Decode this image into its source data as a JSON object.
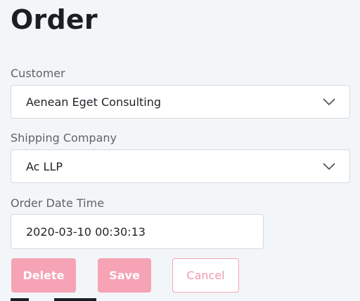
{
  "page": {
    "title": "Order"
  },
  "form": {
    "customer": {
      "label": "Customer",
      "value": "Aenean Eget Consulting"
    },
    "shipping_company": {
      "label": "Shipping Company",
      "value": "Ac LLP"
    },
    "order_date_time": {
      "label": "Order Date Time",
      "value": "2020-03-10 00:30:13"
    }
  },
  "actions": {
    "delete_label": "Delete",
    "save_label": "Save",
    "cancel_label": "Cancel"
  },
  "icons": {
    "dropdown": "chevron-down-icon"
  },
  "colors": {
    "background": "#f3f6f9",
    "primary_button": "#f6a3b6",
    "cancel_text": "#f09aae",
    "label": "#5f6368"
  }
}
